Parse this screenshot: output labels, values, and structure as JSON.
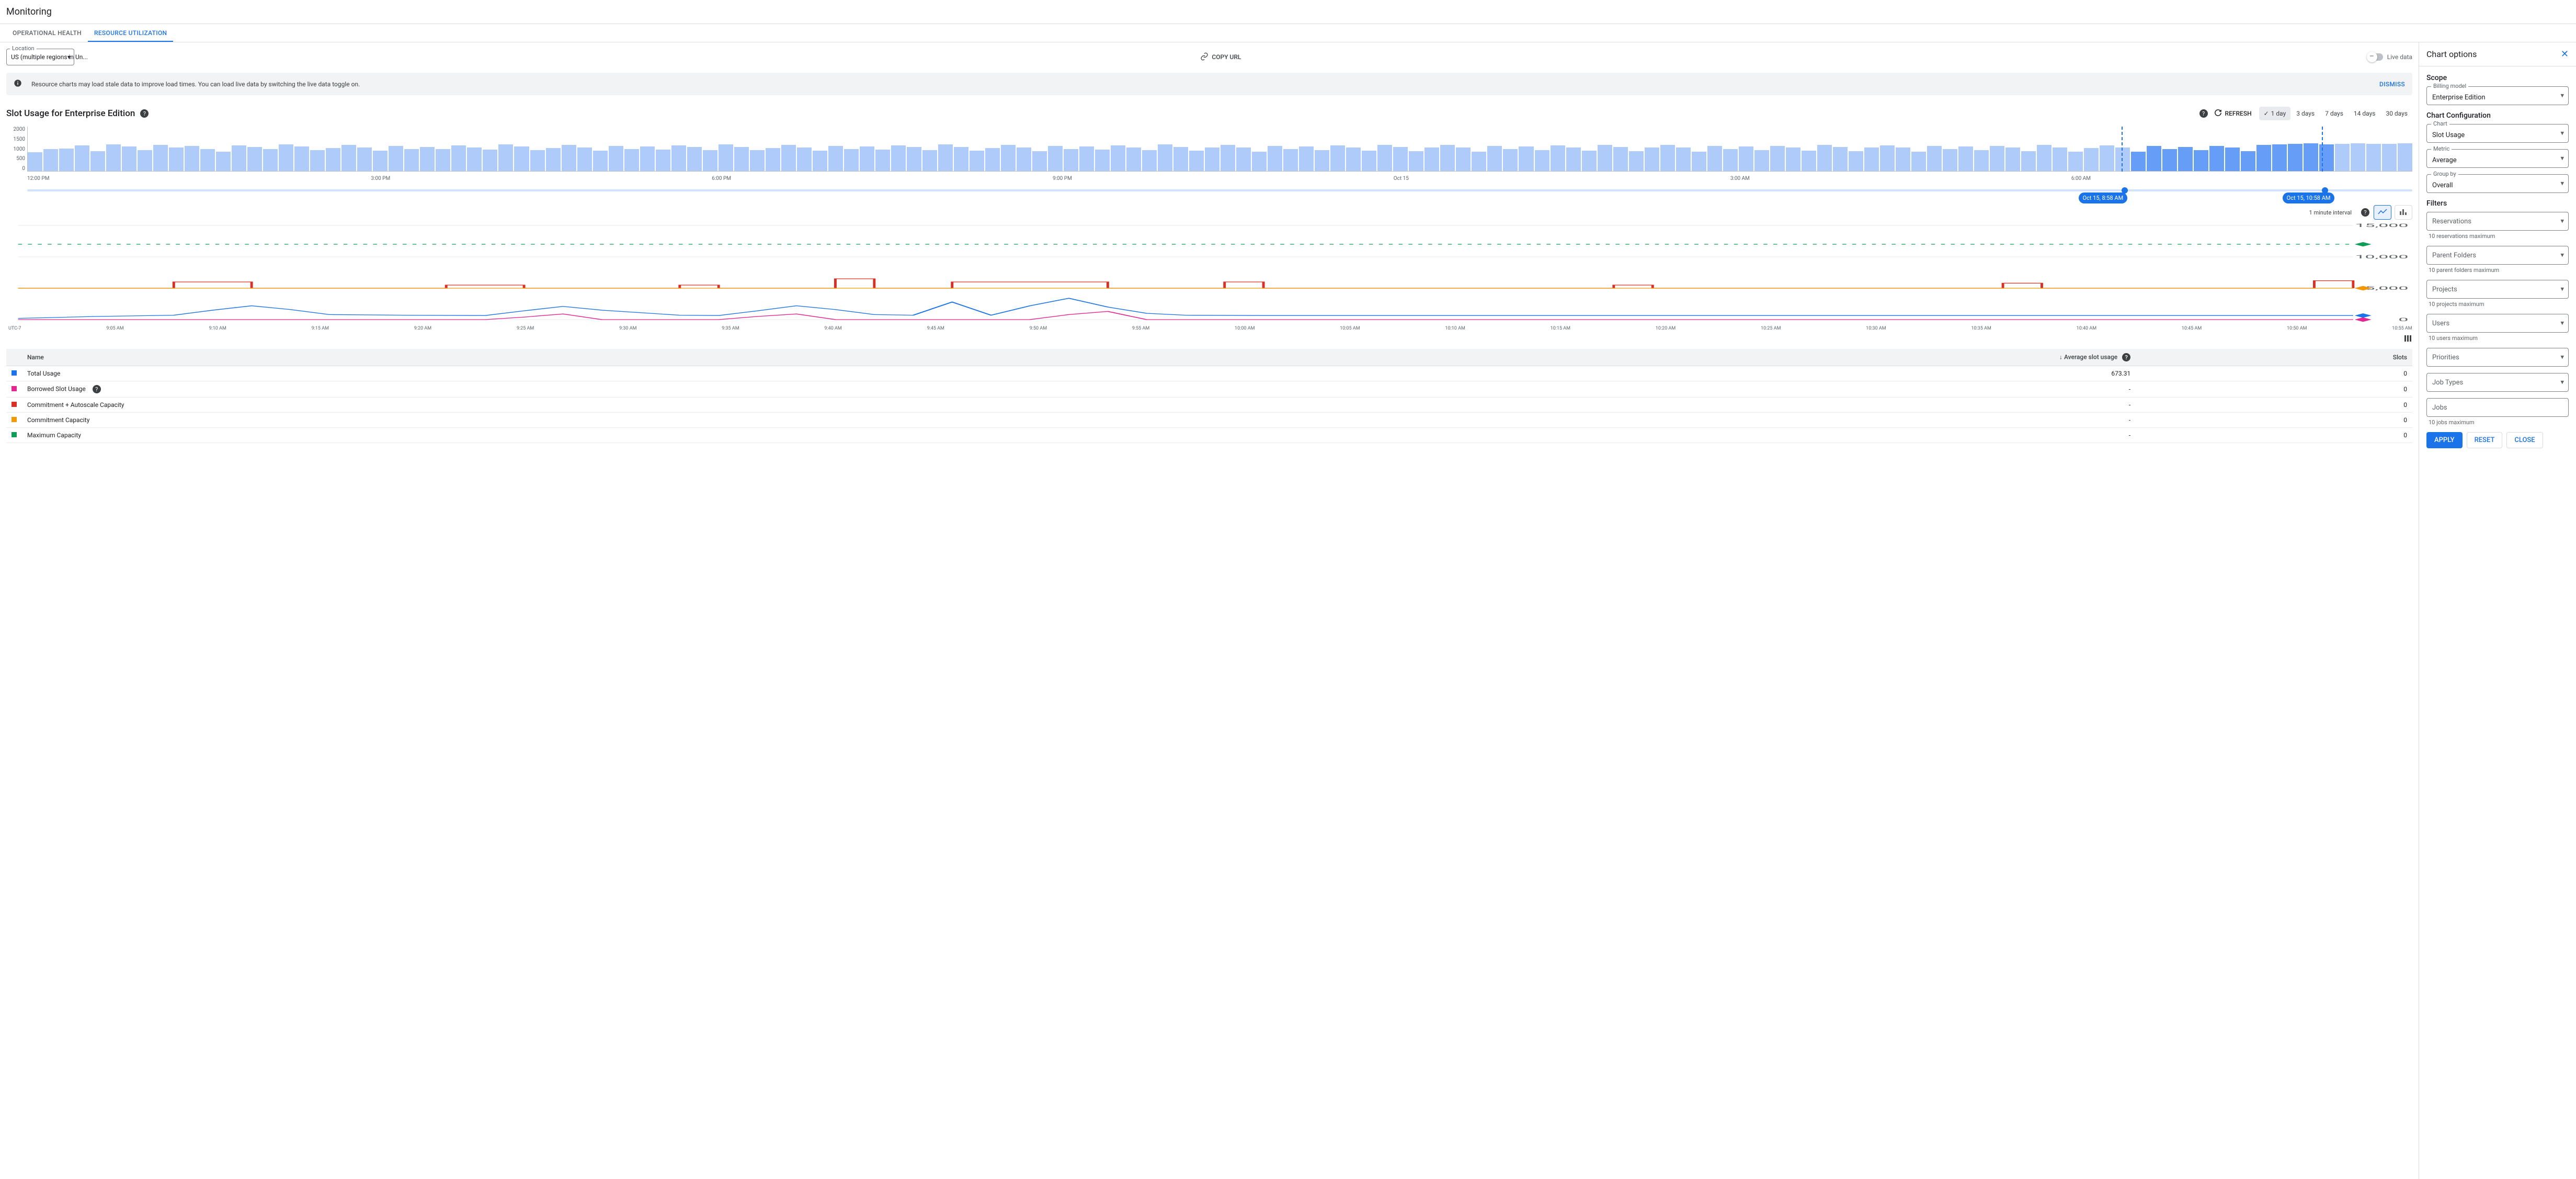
{
  "page_title": "Monitoring",
  "tabs": [
    {
      "label": "OPERATIONAL HEALTH",
      "active": false
    },
    {
      "label": "RESOURCE UTILIZATION",
      "active": true
    }
  ],
  "location": {
    "label": "Location",
    "value": "US (multiple regions in Un..."
  },
  "copy_url_label": "COPY URL",
  "live_data_label": "Live data",
  "info_banner": {
    "text": "Resource charts may load stale data to improve load times. You can load live data by switching the live data toggle on.",
    "dismiss": "DISMISS"
  },
  "slot_section": {
    "title": "Slot Usage for Enterprise Edition",
    "refresh_label": "REFRESH",
    "ranges": [
      "1 day",
      "3 days",
      "7 days",
      "14 days",
      "30 days"
    ],
    "active_range": "1 day"
  },
  "chart_data": {
    "overview": {
      "type": "bar",
      "ylabel": "",
      "xlabel": "",
      "ylim": [
        0,
        2000
      ],
      "y_ticks": [
        2000,
        1500,
        1000,
        500,
        0
      ],
      "x_ticks": [
        "12:00 PM",
        "3:00 PM",
        "6:00 PM",
        "9:00 PM",
        "Oct 15",
        "3:00 AM",
        "6:00 AM",
        ""
      ],
      "values": [
        850,
        980,
        1020,
        1150,
        900,
        1200,
        1100,
        950,
        1180,
        1050,
        1120,
        980,
        870,
        1150,
        1080,
        990,
        1200,
        1100,
        950,
        1030,
        1180,
        1060,
        920,
        1140,
        1000,
        1090,
        980,
        1150,
        1070,
        960,
        1200,
        1100,
        940,
        1030,
        1180,
        1050,
        920,
        1140,
        1000,
        1100,
        970,
        1150,
        1080,
        950,
        1200,
        1090,
        930,
        1040,
        1170,
        1060,
        910,
        1130,
        1000,
        1100,
        960,
        1150,
        1080,
        940,
        1190,
        1090,
        920,
        1040,
        1170,
        1060,
        900,
        1130,
        990,
        1100,
        960,
        1150,
        1070,
        930,
        1190,
        1090,
        910,
        1050,
        1170,
        1060,
        880,
        1130,
        990,
        1100,
        950,
        1150,
        1070,
        920,
        1180,
        1080,
        900,
        1050,
        1170,
        1060,
        870,
        1120,
        990,
        1100,
        950,
        1150,
        1070,
        920,
        1180,
        1080,
        900,
        1050,
        1170,
        1060,
        870,
        1120,
        990,
        1100,
        950,
        1140,
        1060,
        910,
        1170,
        1080,
        890,
        1050,
        1160,
        1060,
        860,
        1120,
        980,
        1100,
        940,
        1140,
        1060,
        900,
        1170,
        1070,
        880,
        1040,
        1160,
        1060,
        860,
        1120,
        980,
        1090,
        940,
        1140,
        1060,
        900,
        1170,
        1210,
        1230,
        1250,
        1210,
        1230,
        1250,
        1220,
        1230,
        1240
      ],
      "selection": {
        "start_label": "Oct 15, 8:58 AM",
        "end_label": "Oct 15, 10:58 AM",
        "start_pct": 87.8,
        "end_pct": 96.2
      }
    },
    "detail": {
      "type": "line",
      "interval_label": "1 minute interval",
      "ylim": [
        0,
        15000
      ],
      "y_ticks": [
        15000,
        10000,
        5000,
        0
      ],
      "x_ticks": [
        "9:05 AM",
        "9:10 AM",
        "9:15 AM",
        "9:20 AM",
        "9:25 AM",
        "9:30 AM",
        "9:35 AM",
        "9:40 AM",
        "9:45 AM",
        "9:50 AM",
        "9:55 AM",
        "10:00 AM",
        "10:05 AM",
        "10:10 AM",
        "10:15 AM",
        "10:20 AM",
        "10:25 AM",
        "10:30 AM",
        "10:35 AM",
        "10:40 AM",
        "10:45 AM",
        "10:50 AM",
        "10:55 AM"
      ],
      "tz_label": "UTC-7",
      "series": [
        {
          "name": "Maximum Capacity",
          "color": "#0f9d58",
          "style": "dotted",
          "constant": 12000
        },
        {
          "name": "Commitment + Autoscale Capacity",
          "color": "#d93025",
          "style": "step",
          "x": [
            0,
            6,
            8,
            10,
            12,
            20,
            22,
            24,
            26,
            32,
            34,
            36,
            40,
            42,
            44,
            46,
            48,
            56,
            58,
            62,
            64,
            80,
            82,
            84,
            100,
            102,
            104,
            116,
            118,
            120
          ],
          "y": [
            5000,
            5000,
            6000,
            6000,
            5000,
            5000,
            5500,
            5500,
            5000,
            5000,
            5500,
            5000,
            5000,
            6500,
            5000,
            5000,
            6000,
            5000,
            5000,
            6000,
            5000,
            5000,
            5500,
            5000,
            5000,
            5800,
            5000,
            5000,
            6200,
            5000
          ]
        },
        {
          "name": "Commitment Capacity",
          "color": "#f29900",
          "style": "solid",
          "constant": 5000
        },
        {
          "name": "Total Usage",
          "color": "#1a73e8",
          "style": "solid",
          "x": [
            0,
            4,
            8,
            10,
            12,
            14,
            16,
            20,
            24,
            26,
            28,
            30,
            34,
            36,
            38,
            40,
            42,
            44,
            46,
            48,
            50,
            52,
            54,
            56,
            58,
            60,
            64,
            68,
            72,
            76,
            80,
            84,
            88,
            92,
            96,
            100,
            104,
            108,
            112,
            116,
            120
          ],
          "y": [
            200,
            500,
            700,
            1500,
            2200,
            1600,
            800,
            700,
            650,
            1400,
            2100,
            1500,
            700,
            650,
            1400,
            2200,
            1600,
            800,
            700,
            2800,
            700,
            2200,
            3400,
            2000,
            1000,
            700,
            650,
            650,
            650,
            650,
            650,
            650,
            650,
            650,
            650,
            650,
            650,
            650,
            650,
            650,
            650
          ]
        },
        {
          "name": "Borrowed Slot Usage",
          "color": "#e52592",
          "style": "solid",
          "x": [
            0,
            24,
            26,
            28,
            30,
            36,
            38,
            40,
            42,
            52,
            54,
            56,
            58,
            120
          ],
          "y": [
            0,
            0,
            400,
            900,
            0,
            0,
            500,
            900,
            0,
            0,
            800,
            1300,
            0,
            0
          ]
        }
      ]
    }
  },
  "legend_table": {
    "columns": {
      "name": "Name",
      "avg": "Average slot usage",
      "slots": "Slots"
    },
    "rows": [
      {
        "color": "#1a73e8",
        "name": "Total Usage",
        "avg": "673.31",
        "slots": "0"
      },
      {
        "color": "#e52592",
        "name": "Borrowed Slot Usage",
        "avg": "-",
        "slots": "0",
        "help": true
      },
      {
        "color": "#d93025",
        "name": "Commitment + Autoscale Capacity",
        "avg": "-",
        "slots": "0"
      },
      {
        "color": "#f29900",
        "name": "Commitment Capacity",
        "avg": "-",
        "slots": "0"
      },
      {
        "color": "#0f9d58",
        "name": "Maximum Capacity",
        "avg": "-",
        "slots": "0"
      }
    ]
  },
  "side_panel": {
    "title": "Chart options",
    "scope": {
      "heading": "Scope",
      "billing_model": {
        "label": "Billing model",
        "value": "Enterprise Edition"
      }
    },
    "config": {
      "heading": "Chart Configuration",
      "chart": {
        "label": "Chart",
        "value": "Slot Usage"
      },
      "metric": {
        "label": "Metric",
        "value": "Average"
      },
      "group_by": {
        "label": "Group by",
        "value": "Overall"
      }
    },
    "filters": {
      "heading": "Filters",
      "reservations": {
        "placeholder": "Reservations",
        "hint": "10 reservations maximum"
      },
      "parent_folders": {
        "placeholder": "Parent Folders",
        "hint": "10 parent folders maximum"
      },
      "projects": {
        "placeholder": "Projects",
        "hint": "10 projects maximum"
      },
      "users": {
        "placeholder": "Users",
        "hint": "10 users maximum"
      },
      "priorities": {
        "placeholder": "Priorities"
      },
      "job_types": {
        "placeholder": "Job Types"
      },
      "jobs": {
        "placeholder": "Jobs",
        "hint": "10 jobs maximum"
      }
    },
    "buttons": {
      "apply": "APPLY",
      "reset": "RESET",
      "close": "CLOSE"
    }
  }
}
